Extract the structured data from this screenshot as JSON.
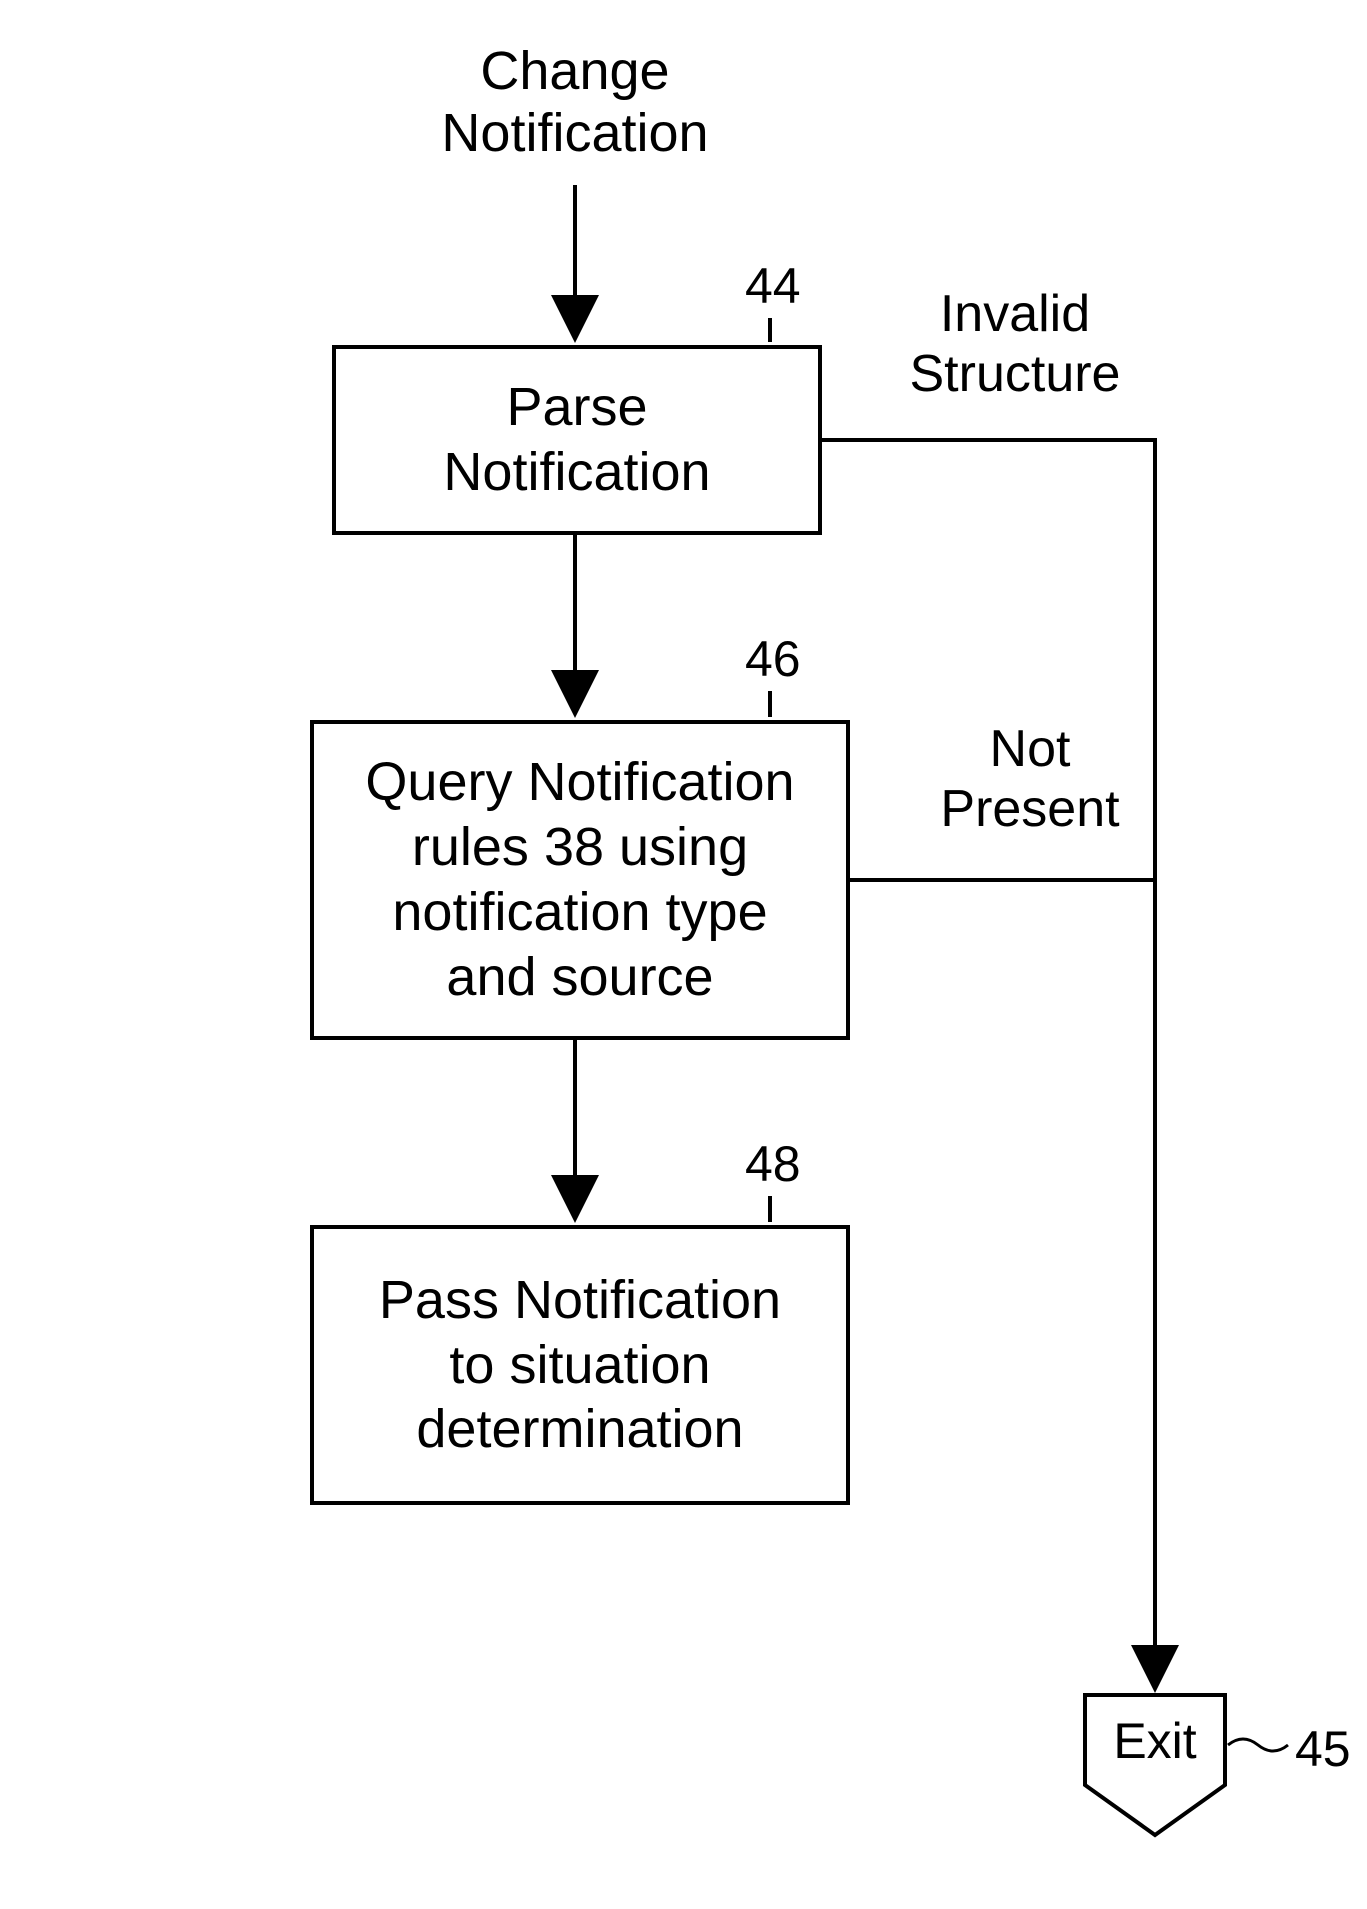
{
  "diagram": {
    "start_label": "Change\nNotification",
    "box44": {
      "text": "Parse\nNotification",
      "ref": "44",
      "branch_label": "Invalid\nStructure"
    },
    "box46": {
      "text": "Query Notification\nrules 38 using\nnotification type\nand source",
      "ref": "46",
      "branch_label": "Not\nPresent"
    },
    "box48": {
      "text": "Pass Notification\nto situation\ndetermination",
      "ref": "48"
    },
    "exit": {
      "text": "Exit",
      "ref": "45"
    }
  }
}
